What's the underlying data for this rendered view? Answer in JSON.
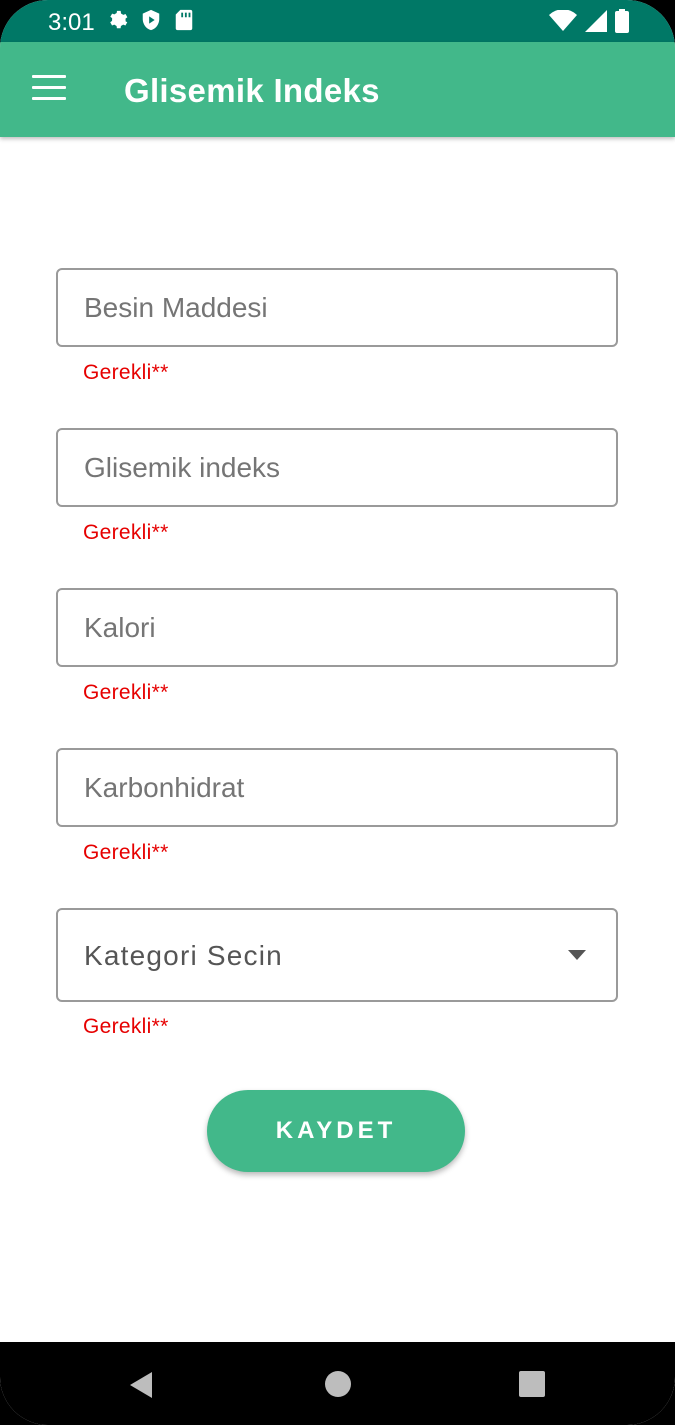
{
  "status_bar": {
    "time": "3:01",
    "left_icons": [
      "settings-gear-icon",
      "shield-play-icon",
      "sd-card-icon"
    ],
    "right_icons": [
      "wifi-icon",
      "cellular-signal-icon",
      "battery-icon"
    ]
  },
  "app_bar": {
    "title": "Glisemik Indeks",
    "menu_icon": "hamburger-menu-icon"
  },
  "form": {
    "food_item": {
      "placeholder": "Besin Maddesi",
      "value": "",
      "error": "Gerekli**"
    },
    "glycemic_index": {
      "placeholder": "Glisemik indeks",
      "value": "",
      "error": "Gerekli**"
    },
    "calorie": {
      "placeholder": "Kalori",
      "value": "",
      "error": "Gerekli**"
    },
    "carbohydrate": {
      "placeholder": "Karbonhidrat",
      "value": "",
      "error": "Gerekli**"
    },
    "category": {
      "selected": "Kategori Secin",
      "error": "Gerekli**",
      "icon": "dropdown-arrow-icon"
    },
    "save_label": "KAYDET"
  },
  "nav_bar": {
    "icons": [
      "back-triangle-icon",
      "home-circle-icon",
      "recents-square-icon"
    ]
  },
  "colors": {
    "primary": "#42b88a",
    "status_bar": "#007866",
    "error": "#e60000"
  }
}
